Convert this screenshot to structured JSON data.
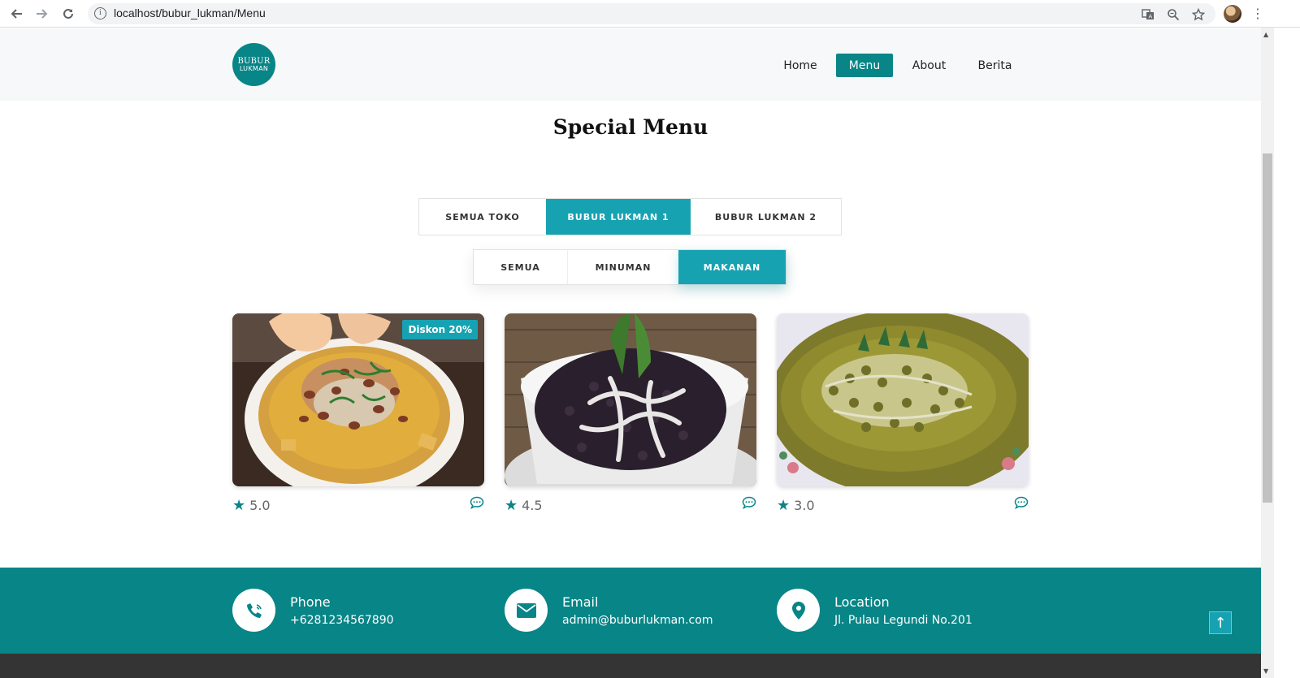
{
  "browser": {
    "url": "localhost/bubur_lukman/Menu",
    "icons": [
      "back-arrow-icon",
      "forward-arrow-icon",
      "reload-icon",
      "info-icon",
      "translate-icon",
      "zoom-icon",
      "star-bookmark-icon",
      "profile-avatar",
      "more-menu-icon"
    ]
  },
  "header": {
    "logo": {
      "line1": "BUBUR",
      "line2": "LUKMAN"
    },
    "nav": [
      {
        "label": "Home"
      },
      {
        "label": "Menu",
        "active": true
      },
      {
        "label": "About"
      },
      {
        "label": "Berita"
      }
    ]
  },
  "main": {
    "title": "Special Menu",
    "store_filters": [
      {
        "label": "SEMUA TOKO"
      },
      {
        "label": "BUBUR LUKMAN 1",
        "active": true
      },
      {
        "label": "BUBUR LUKMAN 2"
      }
    ],
    "category_filters": [
      {
        "label": "SEMUA"
      },
      {
        "label": "MINUMAN"
      },
      {
        "label": "MAKANAN",
        "active": true
      }
    ],
    "items": [
      {
        "rating": "5.0",
        "badge": "Diskon 20%",
        "image": "bubur-ayam"
      },
      {
        "rating": "4.5",
        "badge": "",
        "image": "bubur-ketan-hitam"
      },
      {
        "rating": "3.0",
        "badge": "",
        "image": "bubur-kacang-hijau"
      }
    ]
  },
  "footer": {
    "contacts": [
      {
        "label": "Phone",
        "value": "+6281234567890",
        "icon": "phone-icon"
      },
      {
        "label": "Email",
        "value": "admin@buburlukman.com",
        "icon": "envelope-icon"
      },
      {
        "label": "Location",
        "value": "Jl. Pulau Legundi No.201",
        "icon": "map-pin-icon"
      }
    ],
    "back_to_top": "↑"
  },
  "colors": {
    "brand": "#088587",
    "accent": "#17a2b2",
    "header_bg": "#f6f8f9",
    "footer_bottom": "#343434"
  }
}
